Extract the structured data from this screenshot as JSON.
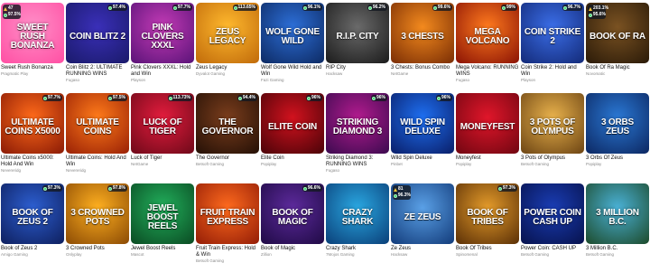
{
  "games": [
    {
      "title": "Sweet Rush Bonanza",
      "provider": "Pragmatic Play",
      "art": "Sweet Rush Bonanza",
      "bg": [
        "#ff8fc8",
        "#ff4fa3"
      ],
      "stack": [
        "47",
        "97.5%"
      ]
    },
    {
      "title": "Coin Blitz 2: ULTIMATE RUNNING WINS",
      "provider": "Fugaso",
      "art": "Coin Blitz 2",
      "bg": [
        "#3a2fb8",
        "#1a1a6a"
      ],
      "rtp": "97.4%"
    },
    {
      "title": "Pink Clovers XXXL: Hold and Win",
      "provider": "Playson",
      "art": "Pink Clovers XXXL",
      "bg": [
        "#c43bb6",
        "#5a1378"
      ],
      "rtp": "97.7%"
    },
    {
      "title": "Zeus Legacy",
      "provider": "Dyvalot Gaming",
      "art": "Zeus Legacy",
      "bg": [
        "#ffb92e",
        "#c06a0a"
      ],
      "rtp": "113.65%"
    },
    {
      "title": "Wolf Gone Wild Hold and Win",
      "provider": "Fazi Gaming",
      "art": "Wolf Gone Wild",
      "bg": [
        "#2d6fd8",
        "#0d2a63"
      ],
      "rtp": "96.1%"
    },
    {
      "title": "RIP City",
      "provider": "Hacksaw",
      "art": "R.I.P. City",
      "bg": [
        "#6a6a6a",
        "#1b1b1b"
      ],
      "rtp": "96.2%"
    },
    {
      "title": "3 Chests: Bonus Combo",
      "provider": "NetGame",
      "art": "3 Chests",
      "bg": [
        "#f38a1e",
        "#7a2d04"
      ],
      "rtp": "99.6%"
    },
    {
      "title": "Mega Volcano: RUNNING WINS",
      "provider": "Fugaso",
      "art": "Mega Volcano",
      "bg": [
        "#ff7a1e",
        "#8a1204"
      ],
      "rtp": "99%"
    },
    {
      "title": "Coin Strike 2: Hold and Win",
      "provider": "Playson",
      "art": "Coin Strike 2",
      "bg": [
        "#3b6ee8",
        "#132a78"
      ],
      "rtp": "96.7%"
    },
    {
      "title": "Book Of Ra Magic",
      "provider": "Novomatic",
      "art": "Book of Ra",
      "bg": [
        "#7a5222",
        "#2a1a08"
      ],
      "stack": [
        "203.1%",
        "95.6%"
      ]
    },
    {
      "title": "Ultimate Coins x5000: Hold And Win",
      "provider": "Nevereridg",
      "art": "Ultimate Coins x5000",
      "bg": [
        "#ff6a1a",
        "#8a1a05"
      ],
      "rtp": "97.7%"
    },
    {
      "title": "Ultimate Coins: Hold And Win",
      "provider": "Nevereridg",
      "art": "Ultimate Coins",
      "bg": [
        "#ff7b1a",
        "#992005"
      ],
      "rtp": "97.5%"
    },
    {
      "title": "Luck of Tiger",
      "provider": "NetGame",
      "art": "Luck of Tiger",
      "bg": [
        "#e31c3d",
        "#6e0919"
      ],
      "rtp": "113.73%"
    },
    {
      "title": "The Governor",
      "provider": "Betsoft Gaming",
      "art": "The Governor",
      "bg": [
        "#7a3d1c",
        "#241006"
      ],
      "rtp": "94.4%"
    },
    {
      "title": "Elite Coin",
      "provider": "Popiplay",
      "art": "Elite Coin",
      "bg": [
        "#d1121e",
        "#4a0308"
      ],
      "rtp": "96%"
    },
    {
      "title": "Striking Diamond 3: RUNNING WINS",
      "provider": "Fugaso",
      "art": "Striking Diamond 3",
      "bg": [
        "#b21b8e",
        "#3b0a4f"
      ],
      "rtp": "96%"
    },
    {
      "title": "Wild Spin Deluxe",
      "provider": "Pinbet",
      "art": "Wild Spin Deluxe",
      "bg": [
        "#1e6ff1",
        "#0a1e68"
      ],
      "rtp": "96%"
    },
    {
      "title": "Moneyfest",
      "provider": "Popiplay",
      "art": "Moneyfest",
      "bg": [
        "#e0162a",
        "#700611"
      ]
    },
    {
      "title": "3 Pots of Olympus",
      "provider": "Betsoft Gaming",
      "art": "3 Pots of Olympus",
      "bg": [
        "#e9b24c",
        "#6c4413"
      ]
    },
    {
      "title": "3 Orbs Of Zeus",
      "provider": "Popiplay",
      "art": "3 Orbs Zeus",
      "bg": [
        "#2a78d4",
        "#0c2761"
      ]
    },
    {
      "title": "Book of Zeus 2",
      "provider": "Amigo Gaming",
      "art": "Book of Zeus 2",
      "bg": [
        "#2d5fd1",
        "#0e1f5e"
      ],
      "rtp": "97.3%"
    },
    {
      "title": "3 Crowned Pots",
      "provider": "Onlyplay",
      "art": "3 Crowned Pots",
      "bg": [
        "#ffb020",
        "#8b4a04"
      ],
      "rtp": "97.8%"
    },
    {
      "title": "Jewel Boost Reels",
      "provider": "Mascot",
      "art": "Jewel Boost Reels",
      "bg": [
        "#22b05c",
        "#0a4a22"
      ]
    },
    {
      "title": "Fruit Train Express: Hold & Win",
      "provider": "Betsoft Gaming",
      "art": "Fruit Train Express",
      "bg": [
        "#ff6b1e",
        "#931c06"
      ]
    },
    {
      "title": "Book of Magic",
      "provider": "Zillion",
      "art": "Book of Magic",
      "bg": [
        "#5d2a9c",
        "#1f0a45"
      ],
      "rtp": "96.6%"
    },
    {
      "title": "Crazy Shark",
      "provider": "7Mojos Gaming",
      "art": "Crazy Shark",
      "bg": [
        "#2aa7e1",
        "#0a3f78"
      ]
    },
    {
      "title": "Ze Zeus",
      "provider": "Hacksaw",
      "art": "Ze Zeus",
      "bg": [
        "#5aa0e6",
        "#123b7a"
      ],
      "stack": [
        "81",
        "96.3%"
      ]
    },
    {
      "title": "Book Of Tribes",
      "provider": "Spinomenal",
      "art": "Book of Tribes",
      "bg": [
        "#e49b2a",
        "#5a2f06"
      ],
      "rtp": "97.3%"
    },
    {
      "title": "Power Coin: CASH UP",
      "provider": "Betsoft Gaming",
      "art": "Power Coin Cash Up",
      "bg": [
        "#1a3db4",
        "#07124d"
      ]
    },
    {
      "title": "3 Million B.C.",
      "provider": "Betsoft Gaming",
      "art": "3 Million B.C.",
      "bg": [
        "#4ab1d6",
        "#1c4a2a"
      ]
    }
  ]
}
